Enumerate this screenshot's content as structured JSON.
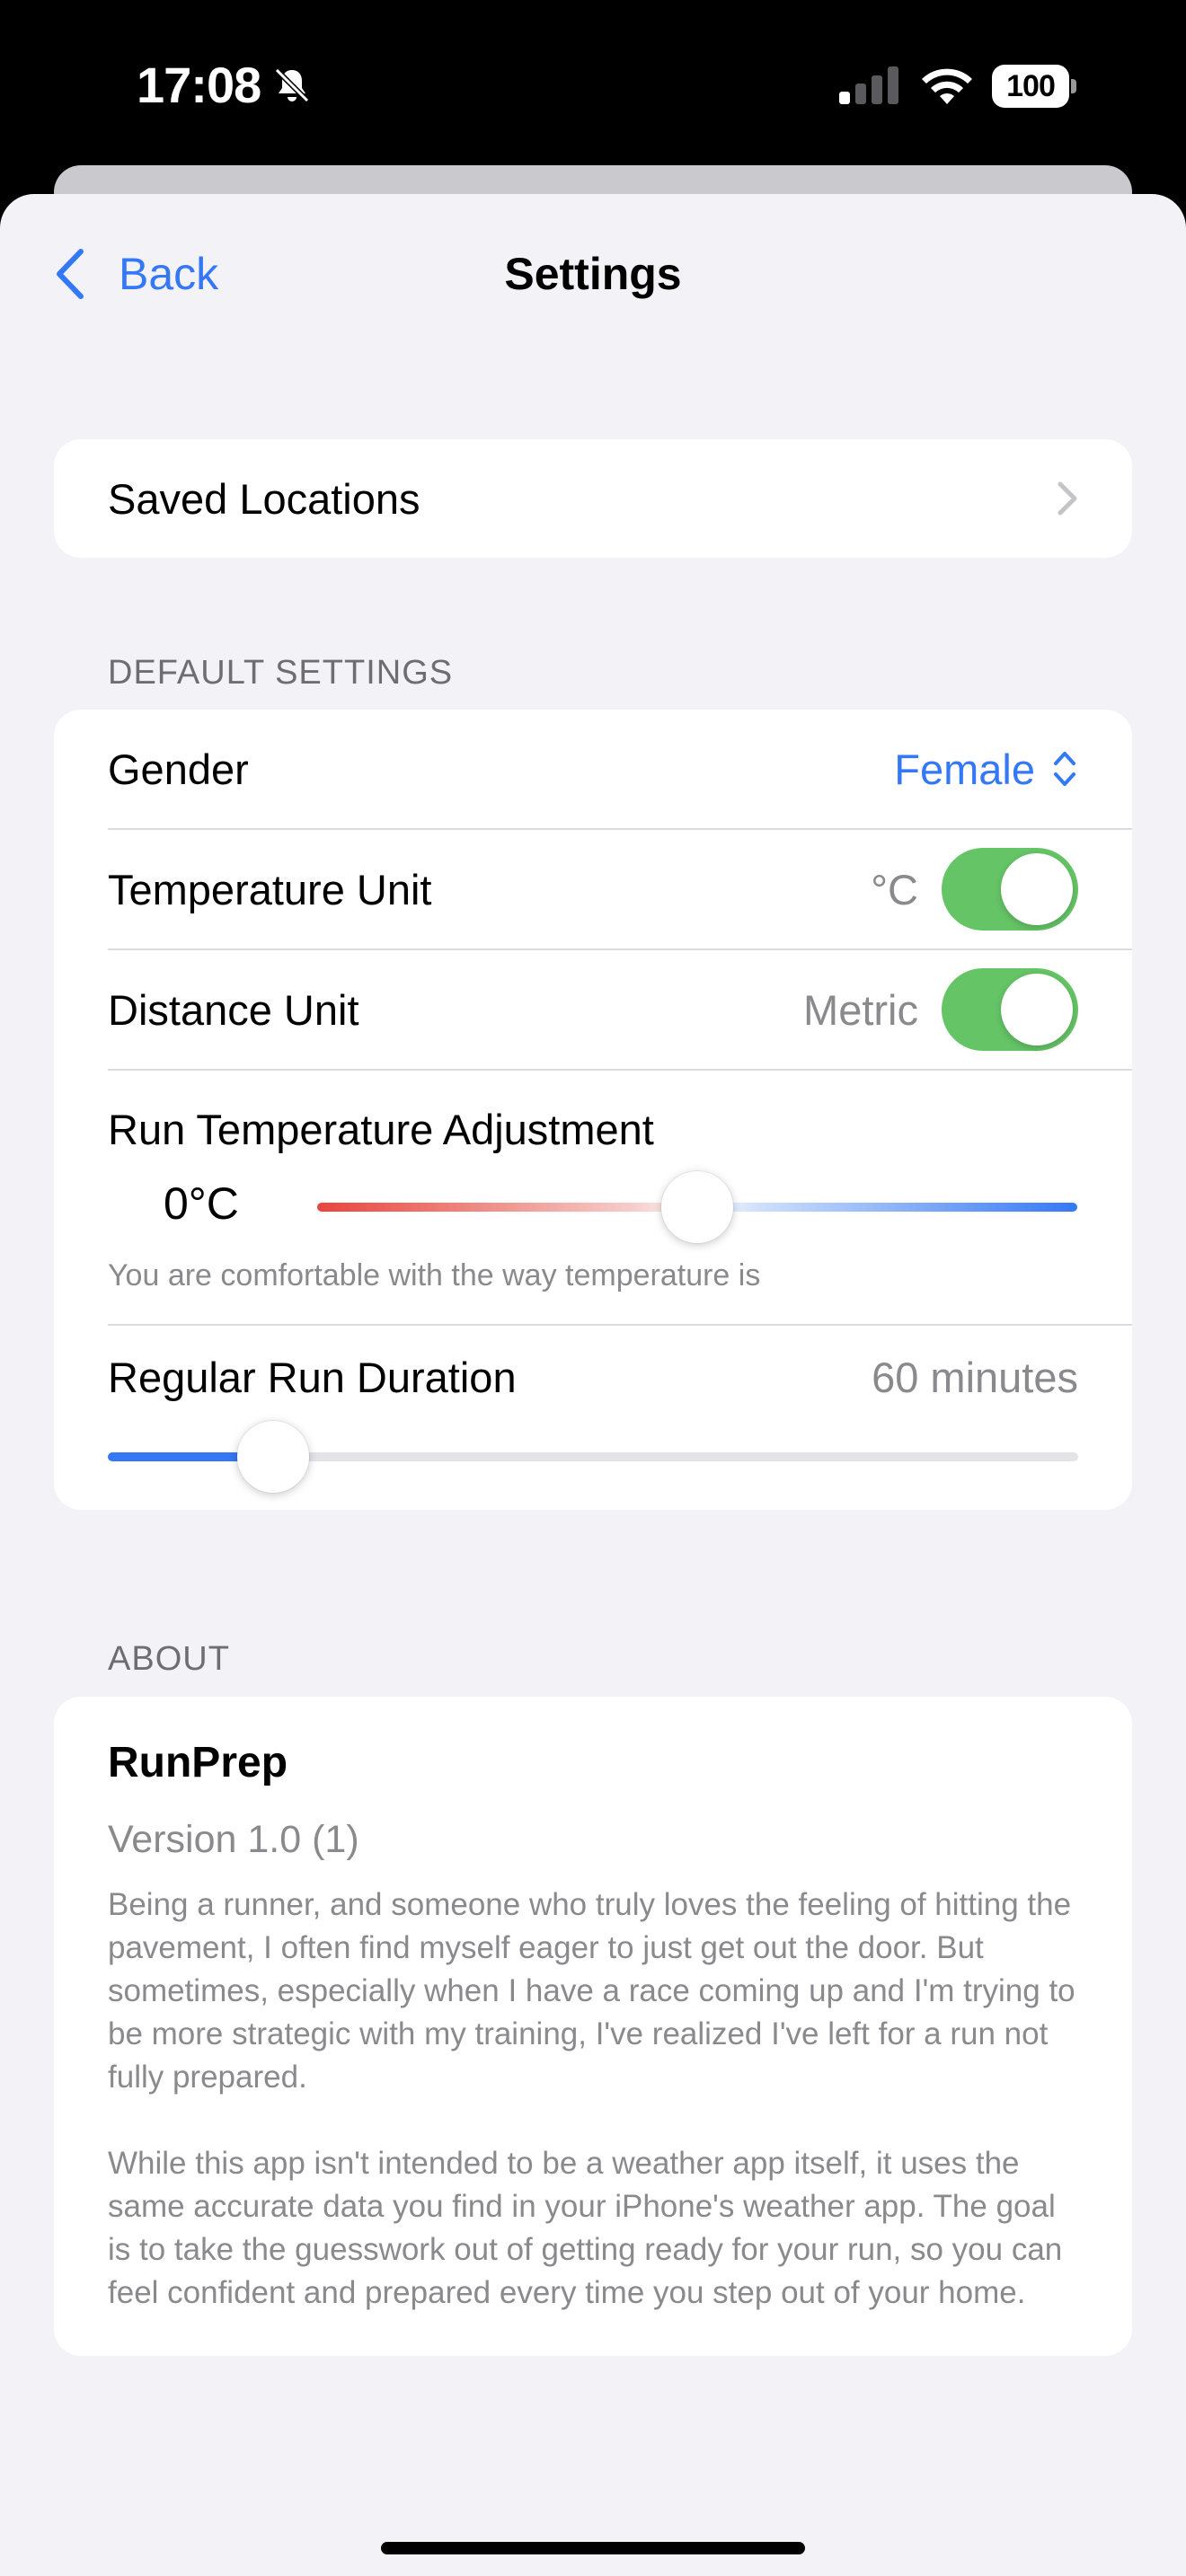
{
  "status": {
    "time": "17:08",
    "battery": "100",
    "icons": [
      "bell-slash-icon",
      "cellular-signal-icon",
      "wifi-icon",
      "battery-icon"
    ]
  },
  "nav": {
    "back_label": "Back",
    "title": "Settings"
  },
  "saved_locations": {
    "label": "Saved Locations"
  },
  "default_settings": {
    "header": "DEFAULT SETTINGS",
    "gender": {
      "label": "Gender",
      "value": "Female"
    },
    "temperature_unit": {
      "label": "Temperature Unit",
      "value": "°C",
      "on": true
    },
    "distance_unit": {
      "label": "Distance Unit",
      "value": "Metric",
      "on": true
    },
    "run_temp_adjustment": {
      "label": "Run Temperature Adjustment",
      "value": "0°C",
      "level": 0.5,
      "caption": "You are comfortable with the way temperature is"
    },
    "run_duration": {
      "label": "Regular Run Duration",
      "value": "60 minutes",
      "level": 0.17
    }
  },
  "about": {
    "header": "ABOUT",
    "app_name": "RunPrep",
    "version": "Version 1.0 (1)",
    "paragraph1": "Being a runner, and someone who truly loves the feeling of hitting the pavement, I often find myself eager to just get out the door. But sometimes, especially when I have a race coming up and I'm trying to be more strategic with my training, I've realized I've left for a run not fully prepared.",
    "paragraph2": "While this app isn't intended to be a weather app itself, it uses the same accurate data you find in your iPhone's weather app. The goal is to take the guesswork out of getting ready for your run, so you can feel confident and prepared every time you step out of your home."
  },
  "colors": {
    "accent": "#3478f6",
    "toggle_on": "#65c466",
    "background": "#f2f2f7",
    "secondary_text": "#8a8a8e",
    "warm": "#e8453c"
  }
}
